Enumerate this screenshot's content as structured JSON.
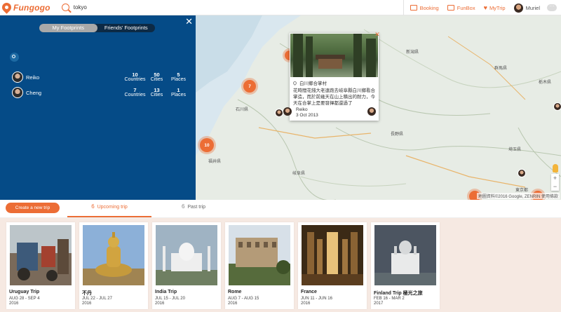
{
  "app": {
    "name": "Fungogo"
  },
  "search": {
    "value": "tokyo"
  },
  "nav": {
    "booking": "Booking",
    "funbox": "FunBox",
    "mytrip": "MyTrip",
    "user": "Muriel"
  },
  "panel": {
    "tabs": [
      "My Footprints",
      "Friends' Footprints"
    ],
    "active_tab": 0,
    "close": "✕",
    "friends": [
      {
        "name": "Reiko",
        "countries": "10",
        "cities": "50",
        "places": "5"
      },
      {
        "name": "Cheng",
        "countries": "7",
        "cities": "13",
        "places": "1"
      }
    ],
    "labels": {
      "countries": "Countries",
      "cities": "Cities",
      "places": "Places"
    }
  },
  "map": {
    "clusters": [
      "7",
      "10"
    ],
    "labels": [
      "石川県",
      "福井県",
      "岐阜県",
      "長野県",
      "埼玉県",
      "東京都",
      "群馬県",
      "栃木県",
      "新潟県"
    ],
    "attribution": "地圖資料©2016 Google, ZENRIN  使用條款"
  },
  "popup": {
    "place": "白川鄉合掌村",
    "description": "花時間花錢大老遠跑去岐阜縣白川鄉看合掌造，而於前幾天在山上積出的耐力，今天在合掌上是要發揮都還過了",
    "author": "Reiko",
    "date": "3 Oct 2013",
    "close": "✕"
  },
  "trips": {
    "create_label": "Create a new trip",
    "upcoming_count": "6",
    "upcoming_label": "Upcoming trip",
    "past_count": "6",
    "past_label": "Past trip",
    "cards": [
      {
        "title": "Uruguay Trip",
        "dates": "AUG 28 - SEP 4",
        "year": "2016"
      },
      {
        "title": "不丹",
        "dates": "JUL 22 - JUL 27",
        "year": "2016"
      },
      {
        "title": "India Trip",
        "dates": "JUL 15 - JUL 20",
        "year": "2016"
      },
      {
        "title": "Rome",
        "dates": "AUG 7 - AUG 15",
        "year": "2016"
      },
      {
        "title": "France",
        "dates": "JUN 11 - JUN 16",
        "year": "2016"
      },
      {
        "title": "Finland Trip 極光之旅",
        "dates": "FEB 16 - MAR 2",
        "year": "2017"
      }
    ]
  },
  "colors": {
    "accent": "#ec6d35",
    "panel": "#054b87"
  }
}
